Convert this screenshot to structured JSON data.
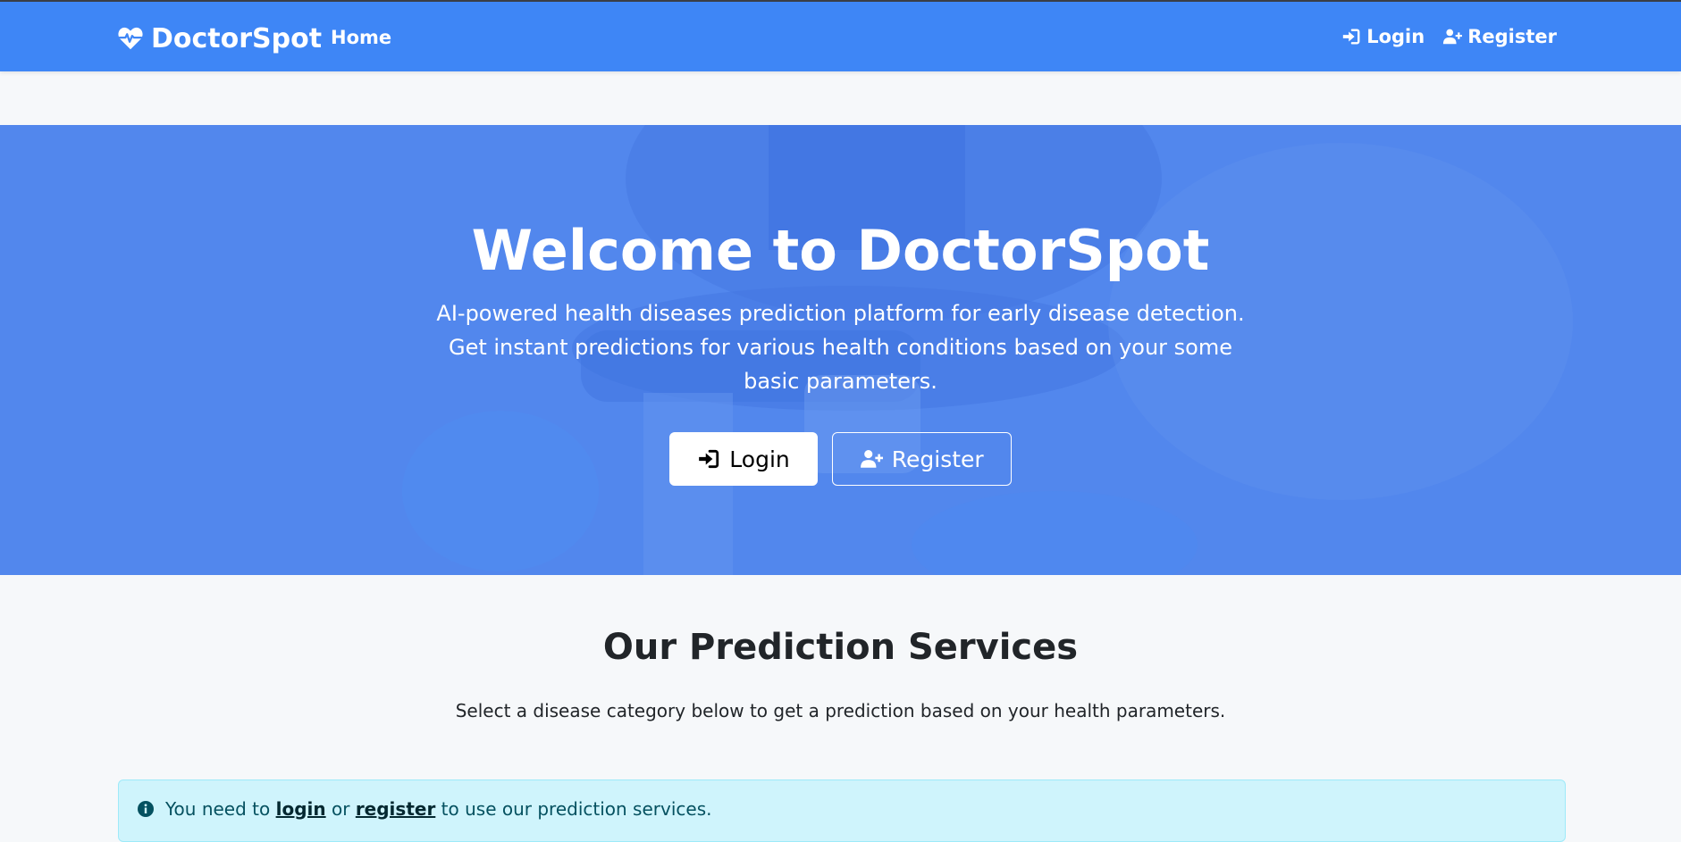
{
  "navbar": {
    "brand": "DoctorSpot",
    "home": "Home",
    "login": "Login",
    "register": "Register"
  },
  "hero": {
    "title": "Welcome to DoctorSpot",
    "text": "AI-powered health diseases prediction platform for early disease detection. Get instant predictions for various health conditions based on your some basic parameters.",
    "login_button": "Login",
    "register_button": "Register"
  },
  "services": {
    "title": "Our Prediction Services",
    "subtitle": "Select a disease category below to get a prediction based on your health parameters."
  },
  "alert": {
    "prefix": "You need to",
    "login_link": "login",
    "middle": "or",
    "register_link": "register",
    "suffix": "to use our prediction services."
  },
  "colors": {
    "navbar": "#3e86f6",
    "hero": "#5488ec",
    "alert_bg": "#cff4fc",
    "alert_text": "#055160"
  },
  "icons": {
    "brand": "heart-pulse-icon",
    "login": "sign-in-icon",
    "register": "user-plus-icon",
    "alert": "info-circle-icon"
  }
}
